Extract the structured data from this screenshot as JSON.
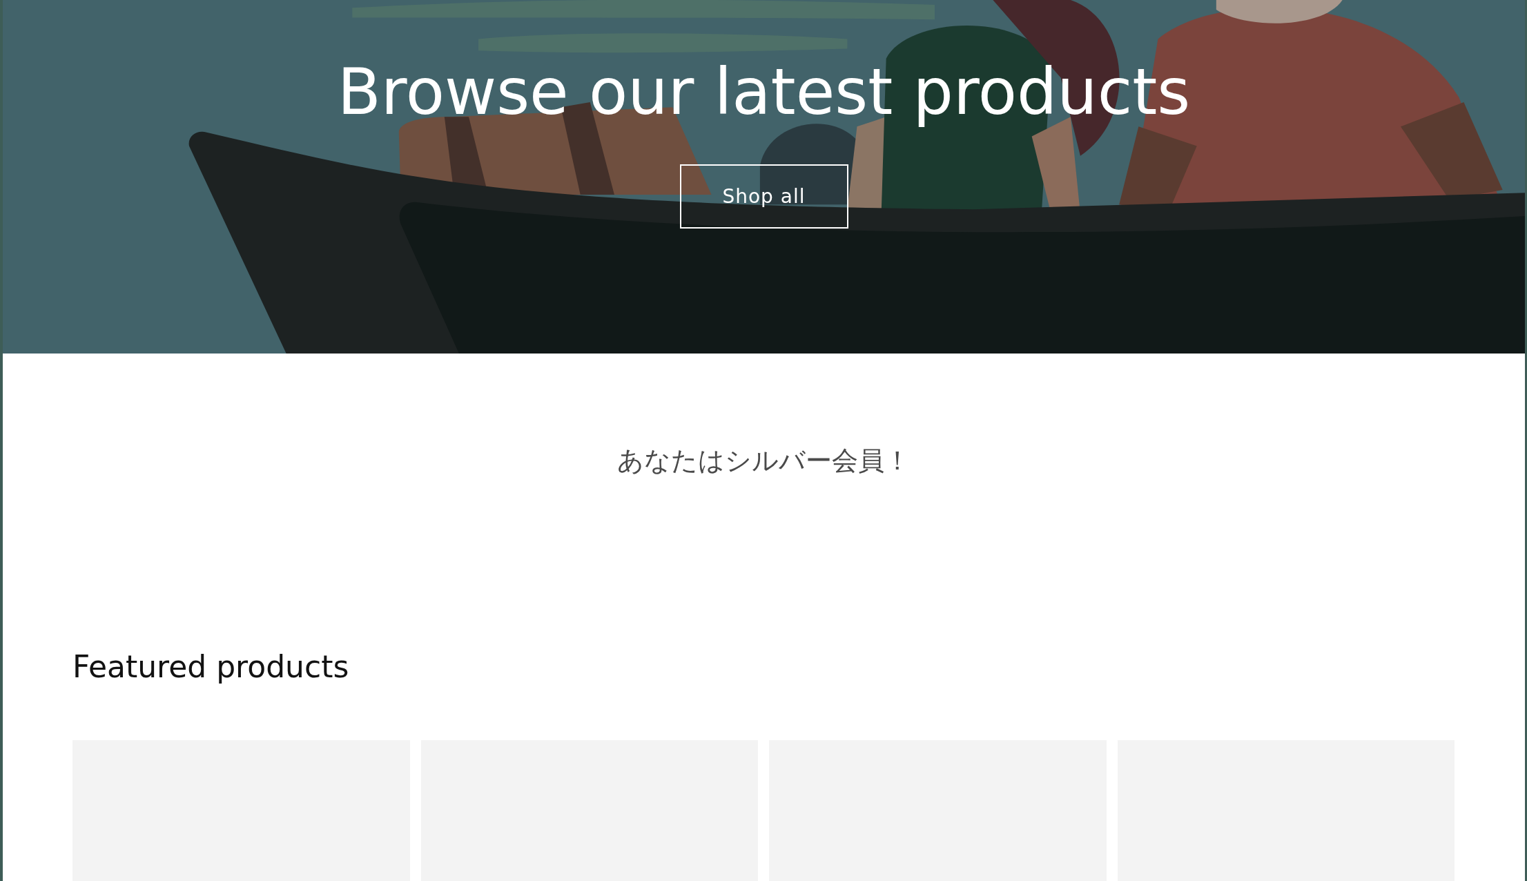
{
  "hero": {
    "kind": "picture",
    "title": "Browse our latest products",
    "button": "Shop all"
  },
  "announcement": "あなたはシルバー会員！",
  "featured": {
    "heading": "Featured products",
    "products": [
      {
        "kind": "placeholder"
      },
      {
        "kind": "placeholder"
      },
      {
        "kind": "placeholder"
      },
      {
        "kind": "placeholder"
      }
    ]
  }
}
